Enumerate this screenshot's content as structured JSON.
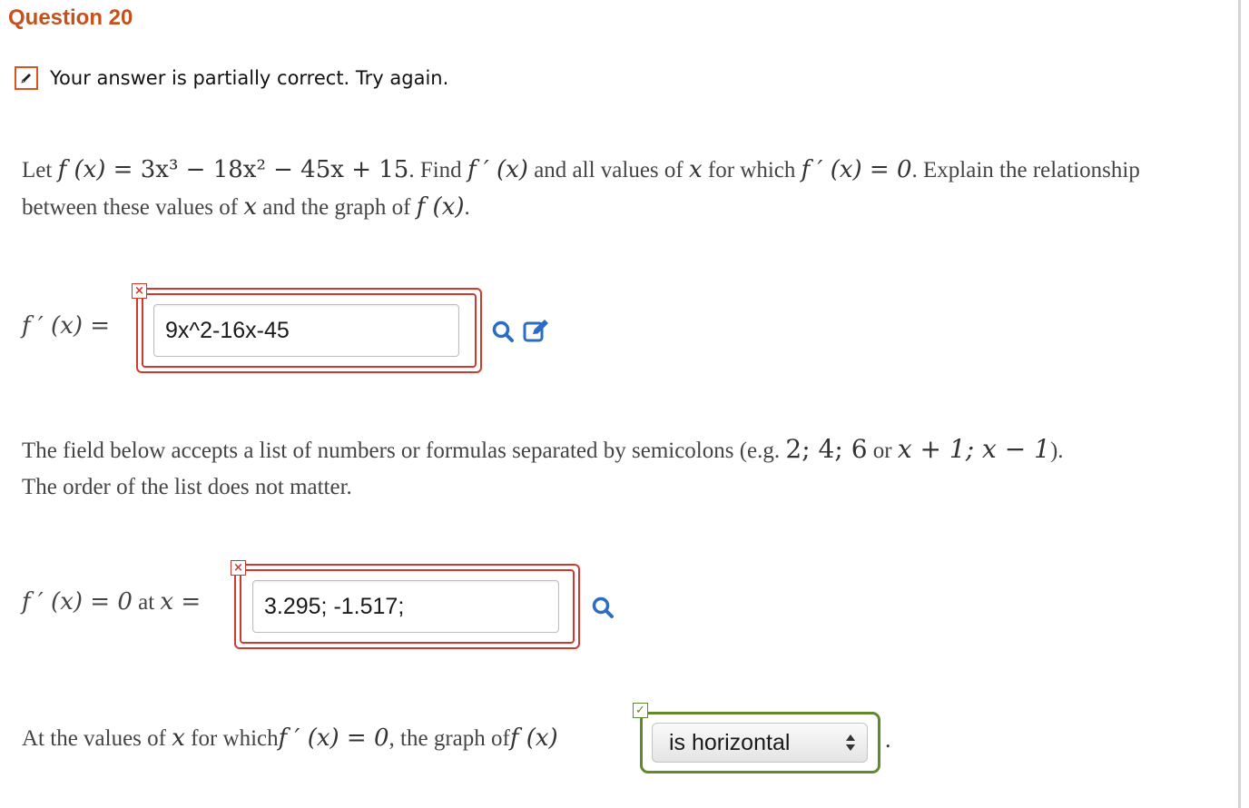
{
  "question": {
    "title": "Question 20"
  },
  "status": {
    "icon": "pencil-icon",
    "message": "Your answer is partially correct.  Try again.",
    "color": "#d9541e"
  },
  "problem": {
    "let": "Let",
    "f_of_x": "f (x)",
    "eq": " = ",
    "poly": "3x³ − 18x² − 45x + 15",
    "find": ". Find",
    "fprime": "f ′ (x)",
    "and_all": " and all values of ",
    "x": "x",
    "for_which": " for which",
    "fprime_zero": "f ′ (x) = 0",
    "explain": ". Explain the relationship between these values of ",
    "graph_of": " and the graph of",
    "end": "."
  },
  "part1": {
    "label": "f ′ (x) =",
    "value": "9x^2-16x-45",
    "mark": "×",
    "icons": [
      "magnifier-icon",
      "edit-icon"
    ]
  },
  "note": {
    "line1": "The field below accepts a list of numbers or formulas separated by semicolons (e.g. ",
    "example1": "2;  4;  6",
    "or": " or ",
    "example2": "x + 1;  x − 1",
    "close": ").",
    "line2": "The order of the list does not matter."
  },
  "part2": {
    "label_math": "f ′ (x) = 0",
    "label_at": " at ",
    "label_x": "x =",
    "value": "3.295; -1.517;",
    "mark": "×",
    "icons": [
      "magnifier-icon"
    ]
  },
  "part3": {
    "prefix": "At the values of ",
    "x": "x",
    "for_which": " for which",
    "cond": "f ′ (x) = 0",
    "graph": ", the graph of",
    "f_of_x": "f (x)",
    "selected": "is horizontal",
    "mark": "✓",
    "tail": "."
  },
  "colors": {
    "error": "#d03a2e",
    "correct": "#5f8b2e",
    "title": "#c5521d",
    "link_icon": "#2b6cc4"
  }
}
